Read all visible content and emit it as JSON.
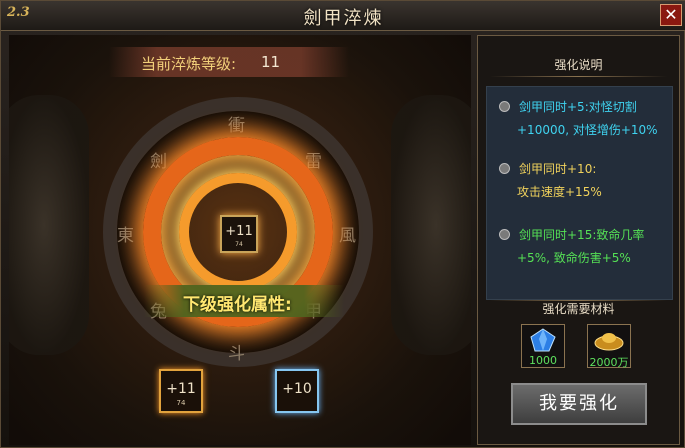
{
  "window": {
    "title": "劍甲淬煉",
    "logo": "2.3"
  },
  "main": {
    "level_label": "当前淬炼等级:",
    "level_value": "11",
    "runes": [
      "衝",
      "雷",
      "風",
      "甲",
      "東",
      "劍",
      "斗",
      "兔"
    ],
    "center": {
      "value": "+11",
      "sub": "74"
    },
    "next_label": "下级强化属性:",
    "slots": [
      {
        "value": "+11",
        "sub": "74"
      },
      {
        "value": "+10",
        "sub": ""
      }
    ]
  },
  "side": {
    "header": "强化说明",
    "entries": [
      {
        "line1": "剑甲同时+5:对怪切割",
        "line2": "+10000, 对怪增伤+10%",
        "color1": "#3fd3f0",
        "color2": "#3fd3f0"
      },
      {
        "line1": "剑甲同时+10:",
        "line2": "攻击速度+15%",
        "color1": "#f1d25c",
        "color2": "#f1d25c"
      },
      {
        "line1": "剑甲同时+15:致命几率",
        "line2": "+5%, 致命伤害+5%",
        "color1": "#55e055",
        "color2": "#55e055"
      }
    ],
    "materials_header": "强化需要材料",
    "materials": [
      {
        "icon": "blue-crystal-icon",
        "qty": "1000"
      },
      {
        "icon": "gold-ingot-icon",
        "qty": "2000万"
      }
    ],
    "upgrade_label": "我要强化"
  }
}
